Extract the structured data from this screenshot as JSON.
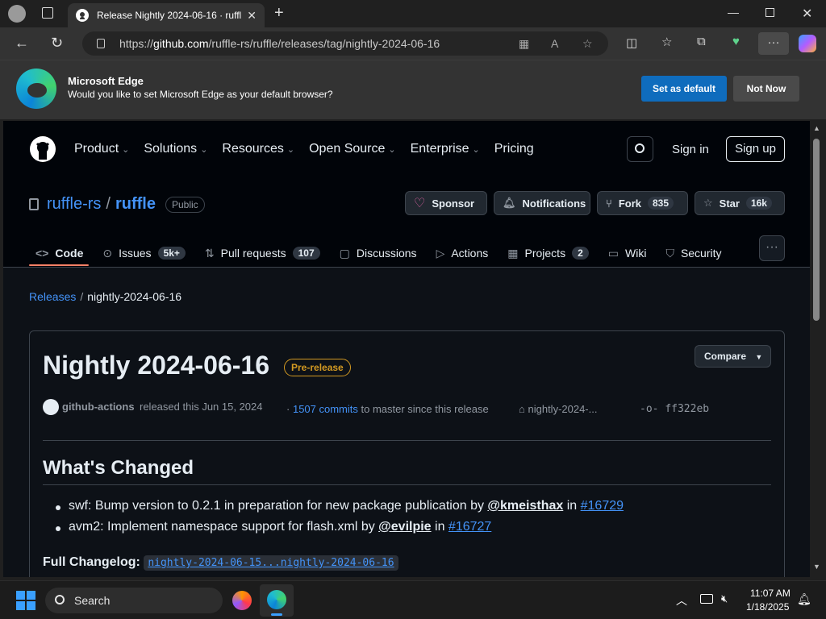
{
  "browser": {
    "tab_title": "Release Nightly 2024-06-16 · ruffl",
    "url_prefix": "https://",
    "url_host": "github.com",
    "url_path": "/ruffle-rs/ruffle/releases/tag/nightly-2024-06-16"
  },
  "banner": {
    "title": "Microsoft Edge",
    "message": "Would you like to set Microsoft Edge as your default browser?",
    "set_default": "Set as default",
    "not_now": "Not Now"
  },
  "gh_header": {
    "nav": [
      "Product",
      "Solutions",
      "Resources",
      "Open Source",
      "Enterprise",
      "Pricing"
    ],
    "sign_in": "Sign in",
    "sign_up": "Sign up"
  },
  "repo": {
    "owner": "ruffle-rs",
    "separator": "/",
    "name": "ruffle",
    "visibility": "Public",
    "sponsor": "Sponsor",
    "notifications": "Notifications",
    "fork_label": "Fork",
    "fork_count": "835",
    "star_label": "Star",
    "star_count": "16k",
    "tabs": [
      {
        "label": "Code",
        "count": ""
      },
      {
        "label": "Issues",
        "count": "5k+"
      },
      {
        "label": "Pull requests",
        "count": "107"
      },
      {
        "label": "Discussions",
        "count": ""
      },
      {
        "label": "Actions",
        "count": ""
      },
      {
        "label": "Projects",
        "count": "2"
      },
      {
        "label": "Wiki",
        "count": ""
      },
      {
        "label": "Security",
        "count": ""
      }
    ],
    "more": "···"
  },
  "breadcrumb": {
    "releases": "Releases",
    "separator": "/",
    "current": "nightly-2024-06-16"
  },
  "release": {
    "title": "Nightly 2024-06-16",
    "badge": "Pre-release",
    "compare": "Compare",
    "actor": "github-actions",
    "released_text": "released this Jun 15, 2024",
    "commits_dot": "·",
    "commits_link": "1507 commits",
    "commits_tail": "to master since this release",
    "tag": "nightly-2024-...",
    "sha": "ff322eb",
    "heading": "What's Changed",
    "changes": [
      {
        "text": "swf: Bump version to 0.2.1 in preparation for new package publication by ",
        "user": "@kmeisthax",
        "in": " in ",
        "pr": "#16729"
      },
      {
        "text": "avm2: Implement namespace support for flash.xml by ",
        "user": "@evilpie",
        "in": " in ",
        "pr": "#16727"
      }
    ],
    "full_changelog_label": "Full Changelog",
    "full_changelog_colon": ":",
    "full_changelog_link": "nightly-2024-06-15...nightly-2024-06-16"
  },
  "taskbar": {
    "search": "Search",
    "time": "11:07 AM",
    "date": "1/18/2025"
  },
  "colors": {
    "accent_blue": "#4493f8",
    "prerelease": "#d29922",
    "tab_underline": "#f78166",
    "edge_button": "#0f6cbd"
  }
}
